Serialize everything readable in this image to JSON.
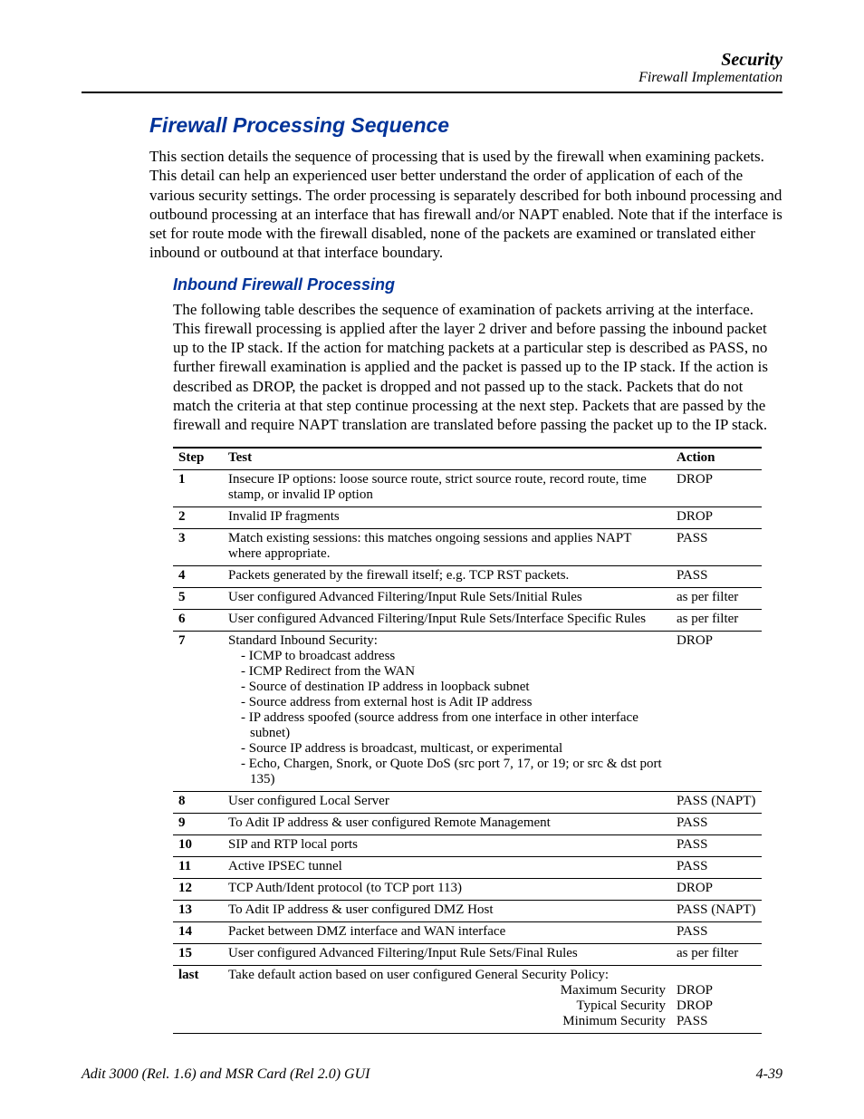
{
  "runningHead": {
    "chapter": "Security",
    "section": "Firewall Implementation"
  },
  "h1": "Firewall Processing Sequence",
  "intro": "This section details the sequence of processing that is used by the firewall when examining packets. This detail can help an experienced user better understand the order of application of each of the various security settings. The order processing is separately described for both inbound processing and outbound processing at an interface that has firewall and/or NAPT enabled. Note that if the interface is set for route mode with the firewall disabled, none of the packets are examined or translated either inbound or outbound at that interface boundary.",
  "h2": "Inbound Firewall Processing",
  "subIntro": "The following table describes the sequence of examination of packets arriving at the interface. This firewall processing is applied after the layer 2 driver and before passing the inbound packet up to the IP stack. If the action for matching packets at a particular step is described as PASS, no further firewall examination is applied and the packet is passed up to the IP stack. If the action is described as DROP, the packet is dropped and not passed up to the stack. Packets that do not match the criteria at that step continue processing at the next step. Packets that are passed by the firewall and require NAPT translation are translated before passing the packet up to the IP stack.",
  "table": {
    "headers": {
      "step": "Step",
      "test": "Test",
      "action": "Action"
    },
    "rows": [
      {
        "step": "1",
        "test": "Insecure IP options: loose source route, strict source route, record route, time stamp, or invalid IP option",
        "action": "DROP"
      },
      {
        "step": "2",
        "test": "Invalid IP fragments",
        "action": "DROP"
      },
      {
        "step": "3",
        "test": "Match existing sessions: this matches ongoing sessions and applies NAPT where appropriate.",
        "action": "PASS"
      },
      {
        "step": "4",
        "test": "Packets generated by the firewall itself; e.g. TCP RST packets.",
        "action": "PASS"
      },
      {
        "step": "5",
        "test": "User configured Advanced Filtering/Input Rule Sets/Initial Rules",
        "action": "as per filter"
      },
      {
        "step": "6",
        "test": "User configured Advanced Filtering/Input Rule Sets/Interface Specific Rules",
        "action": "as per filter"
      },
      {
        "step": "7",
        "testHead": "Standard Inbound Security:",
        "testList": [
          "- ICMP to broadcast address",
          "- ICMP Redirect from the WAN",
          "- Source of destination IP address in loopback subnet",
          "- Source address from external host is Adit IP address",
          "- IP address spoofed (source address from one interface in other interface subnet)",
          "- Source IP address is broadcast, multicast, or experimental",
          "- Echo, Chargen, Snork, or Quote DoS (src port 7, 17, or 19; or src & dst port 135)"
        ],
        "action": "DROP"
      },
      {
        "step": "8",
        "test": "User configured Local Server",
        "action": "PASS (NAPT)"
      },
      {
        "step": "9",
        "test": "To Adit IP address & user configured Remote Management",
        "action": "PASS"
      },
      {
        "step": "10",
        "test": "SIP and RTP local ports",
        "action": "PASS"
      },
      {
        "step": "11",
        "test": "Active IPSEC tunnel",
        "action": "PASS"
      },
      {
        "step": "12",
        "test": "TCP Auth/Ident protocol (to TCP port 113)",
        "action": "DROP"
      },
      {
        "step": "13",
        "test": "To Adit IP address & user configured DMZ Host",
        "action": "PASS (NAPT)"
      },
      {
        "step": "14",
        "test": "Packet between DMZ interface and WAN interface",
        "action": "PASS"
      },
      {
        "step": "15",
        "test": "User configured Advanced Filtering/Input Rule Sets/Final Rules",
        "action": "as per filter"
      },
      {
        "step": "last",
        "lastHead": "Take default action based on user configured General Security Policy:",
        "lastTests": [
          "Maximum Security",
          "Typical Security",
          "Minimum Security"
        ],
        "lastActions": [
          "DROP",
          "DROP",
          "PASS"
        ]
      }
    ]
  },
  "footer": {
    "left": "Adit 3000 (Rel. 1.6) and MSR Card (Rel 2.0) GUI",
    "right": "4-39"
  }
}
